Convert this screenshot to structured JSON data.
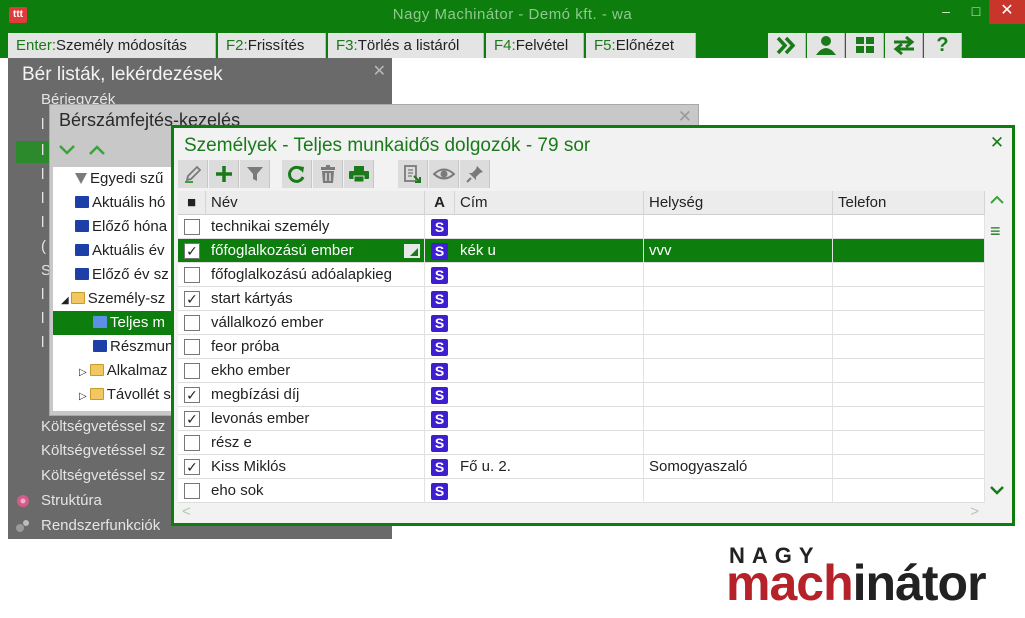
{
  "window": {
    "title": "Nagy Machinátor - Demó kft. - wa",
    "app_icon_text": "ttt",
    "min": "–",
    "max": "□",
    "close": "✕"
  },
  "toolbar": {
    "keys": [
      {
        "key": "Enter:",
        "label": "Személy módosítás"
      },
      {
        "key": "F2:",
        "label": "Frissítés"
      },
      {
        "key": "F3:",
        "label": "Törlés a listáról"
      },
      {
        "key": "F4:",
        "label": "Felvétel"
      },
      {
        "key": "F5:",
        "label": "Előnézet"
      }
    ],
    "icons": [
      "fast-forward-icon",
      "user-icon",
      "grid-icon",
      "swap-icon",
      "help-icon"
    ],
    "help_label": "?"
  },
  "left_panel": {
    "title": "Bér listák, lekérdezések",
    "close": "✕",
    "items": [
      {
        "label": "Bérjegyzék"
      },
      {
        "label": "Költségvetéssel sz"
      },
      {
        "label": "Költségvetéssel sz"
      },
      {
        "label": "Költségvetéssel sz"
      },
      {
        "label": "Struktúra"
      },
      {
        "label": "Rendszerfunkciók"
      }
    ],
    "stub_letters": [
      "l",
      "l",
      "l",
      "l",
      "l",
      "(",
      "S",
      "l",
      "l",
      "l"
    ]
  },
  "middle_panel": {
    "title": "Bérszámfejtés-kezelés",
    "close": "✕",
    "tree": [
      {
        "label": "Egyedi szű",
        "icon": "filter-icon"
      },
      {
        "label": "Aktuális hó",
        "icon": "computer-icon"
      },
      {
        "label": "Előző hóna",
        "icon": "computer-icon"
      },
      {
        "label": "Aktuális év",
        "icon": "computer-icon"
      },
      {
        "label": "Előző év sz",
        "icon": "computer-icon"
      },
      {
        "label": "Személy-sz",
        "icon": "folder-icon",
        "expanded": true
      },
      {
        "label": "Teljes m",
        "icon": "computer-icon",
        "selected": true
      },
      {
        "label": "Részmun",
        "icon": "computer-icon"
      },
      {
        "label": "Alkalmaz",
        "icon": "folder-icon"
      },
      {
        "label": "Távollét s",
        "icon": "folder-icon"
      }
    ]
  },
  "dialog": {
    "title": "Személyek - Teljes munkaidős dolgozók - 79 sor",
    "close": "✕",
    "toolbar_icons": [
      "edit-icon",
      "add-icon",
      "filter-icon",
      "refresh-icon",
      "delete-icon",
      "print-icon",
      "export-icon",
      "view-icon",
      "pin-icon"
    ],
    "columns": {
      "check": "■",
      "name": "Név",
      "a": "A",
      "address": "Cím",
      "city": "Helység",
      "phone": "Telefon"
    },
    "rows": [
      {
        "checked": "",
        "name": "technikai személy",
        "badge": "S",
        "address": "",
        "city": "",
        "phone": ""
      },
      {
        "checked": "✓",
        "name": "főfoglalkozású ember",
        "badge": "S",
        "address": "kék u",
        "city": "vvv",
        "phone": "",
        "selected": true
      },
      {
        "checked": "",
        "name": "főfoglalkozású adóalapkieg",
        "badge": "S",
        "address": "",
        "city": "",
        "phone": ""
      },
      {
        "checked": "✓",
        "name": "start kártyás",
        "badge": "S",
        "address": "",
        "city": "",
        "phone": ""
      },
      {
        "checked": "",
        "name": "vállalkozó ember",
        "badge": "S",
        "address": "",
        "city": "",
        "phone": ""
      },
      {
        "checked": "",
        "name": "feor próba",
        "badge": "S",
        "address": "",
        "city": "",
        "phone": ""
      },
      {
        "checked": "",
        "name": "ekho ember",
        "badge": "S",
        "address": "",
        "city": "",
        "phone": ""
      },
      {
        "checked": "✓",
        "name": "megbízási díj",
        "badge": "S",
        "address": "",
        "city": "",
        "phone": ""
      },
      {
        "checked": "✓",
        "name": "levonás ember",
        "badge": "S",
        "address": "",
        "city": "",
        "phone": ""
      },
      {
        "checked": "",
        "name": "rész e",
        "badge": "S",
        "address": "",
        "city": "",
        "phone": ""
      },
      {
        "checked": "✓",
        "name": "Kiss Miklós",
        "badge": "S",
        "address": "Fő u. 2.",
        "city": "Somogyaszaló",
        "phone": ""
      },
      {
        "checked": "",
        "name": "eho sok",
        "badge": "S",
        "address": "",
        "city": "",
        "phone": ""
      }
    ],
    "scroll": {
      "up": "^",
      "menu": "≡",
      "left": "<",
      "right": ">"
    }
  },
  "logo": {
    "top": "NAGY",
    "part1": "mach",
    "part2": "in",
    "part3": "átor"
  },
  "colors": {
    "brand_green": "#0d7d0d",
    "badge_blue": "#3d1fd0",
    "logo_red": "#b5222a",
    "close_red": "#c7352b"
  }
}
